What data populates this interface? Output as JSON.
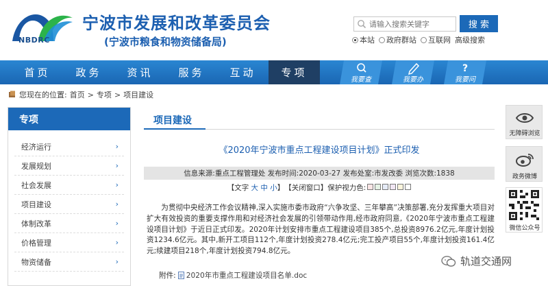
{
  "header": {
    "logo_text": "NBDRC",
    "org_title": "宁波市发展和改革委员会",
    "org_subtitle": "(宁波市粮食和物资储备局)"
  },
  "search": {
    "placeholder": "请输入搜索关键字",
    "button_label": "搜 索",
    "scopes": [
      {
        "label": "本站",
        "selected": true
      },
      {
        "label": "政府群站",
        "selected": false
      },
      {
        "label": "互联网",
        "selected": false
      }
    ],
    "advanced_label": "高级搜索"
  },
  "nav": {
    "items": [
      "首页",
      "政务",
      "资讯",
      "服务",
      "互动",
      "专项"
    ],
    "active_index": 5,
    "quick": [
      "我要查",
      "我要办",
      "我要问"
    ]
  },
  "breadcrumb": {
    "prefix": "您现在的位置:",
    "items": [
      "首页",
      "专项",
      "项目建设"
    ],
    "separator": ">"
  },
  "sidebar": {
    "title": "专项",
    "items": [
      "经济运行",
      "发展规划",
      "社会发展",
      "项目建设",
      "体制改革",
      "价格管理",
      "物资储备"
    ]
  },
  "main": {
    "section_title": "项目建设",
    "article_title": "《2020年宁波市重点工程建设项目计划》正式印发",
    "meta": "信息来源:重点工程管理处 发布时间:2020-03-27 发布处室:市发改委 浏览次数:1838",
    "tools": {
      "text_label": "【文字",
      "size_large": "大",
      "size_medium": "中",
      "size_small": "小",
      "text_close": "】",
      "close_window": "【关闭窗口】",
      "eye_protect": "保护视力色:"
    },
    "swatches": [
      "#fbe6e6",
      "#e6f3e6",
      "#e6ecf8",
      "#f1e6f3",
      "#fbf5dd",
      "#ffffff"
    ],
    "body": "为贯彻中央经济工作会议精神,深入实施市委市政府“六争攻坚、三年攀高”决策部署,充分发挥重大项目对扩大有效投资的重要支撑作用和对经济社会发展的引领带动作用,经市政府同意,《2020年宁波市重点工程建设项目计划》于近日正式印发。2020年计划安排市重点工程建设项目385个,总投资8976.2亿元,年度计划投资1234.6亿元。其中,新开工项目112个,年度计划投资278.4亿元;完工投产项目55个,年度计划投资161.4亿元;续建项目218个,年度计划投资794.8亿元。",
    "attachment_label": "附件:",
    "attachment_file": "2020年市重点工程建设项目名单.doc"
  },
  "widgets": {
    "accessible": "无障碍浏览",
    "weibo": "政务微博",
    "wechat": "微信公众号"
  },
  "watermark": "轨道交通网"
}
